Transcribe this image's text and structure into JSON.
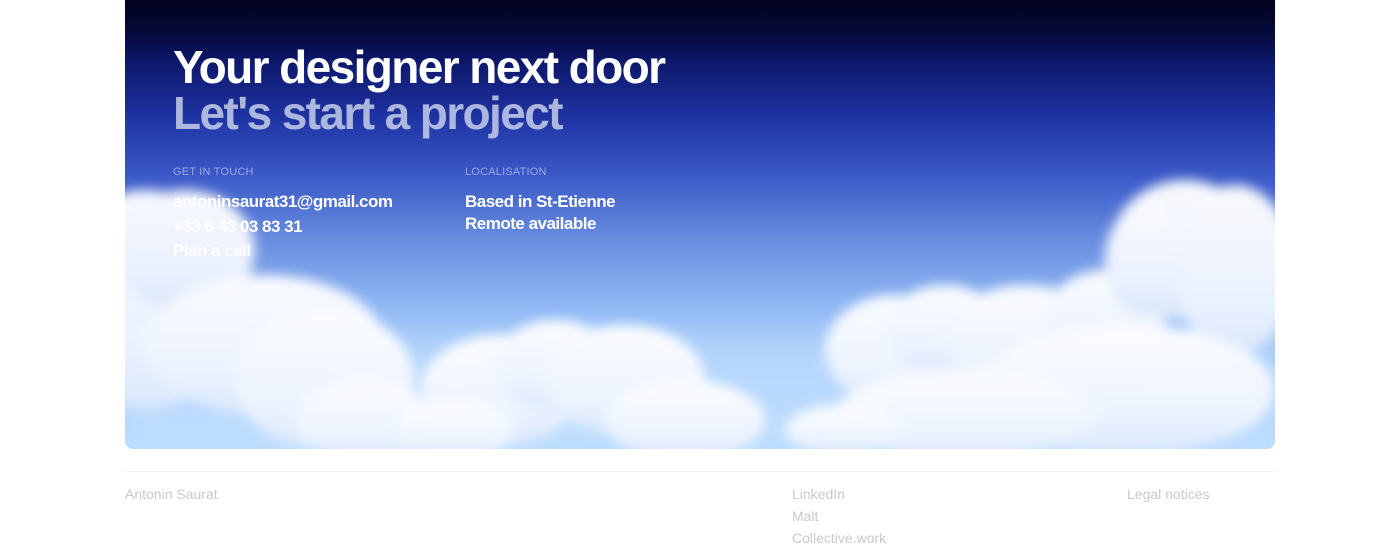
{
  "hero": {
    "title": "Your designer next door",
    "subtitle": "Let's start a project"
  },
  "contact": {
    "label": "GET IN TOUCH",
    "email": "antoninsaurat31@gmail.com",
    "phone": "+33 6 43 03 83 31",
    "call": "Plan a call"
  },
  "location": {
    "label": "LOCALISATION",
    "city": "Based in St-Etienne",
    "remote": "Remote available"
  },
  "footer": {
    "name": "Antonin Saurat",
    "links": [
      "LinkedIn",
      "Malt",
      "Collective.work"
    ],
    "legal": "Legal notices"
  },
  "colors": {
    "sky_top": "#050735",
    "sky_bottom": "#b9dcff",
    "footer_text": "#c9c9c9"
  }
}
